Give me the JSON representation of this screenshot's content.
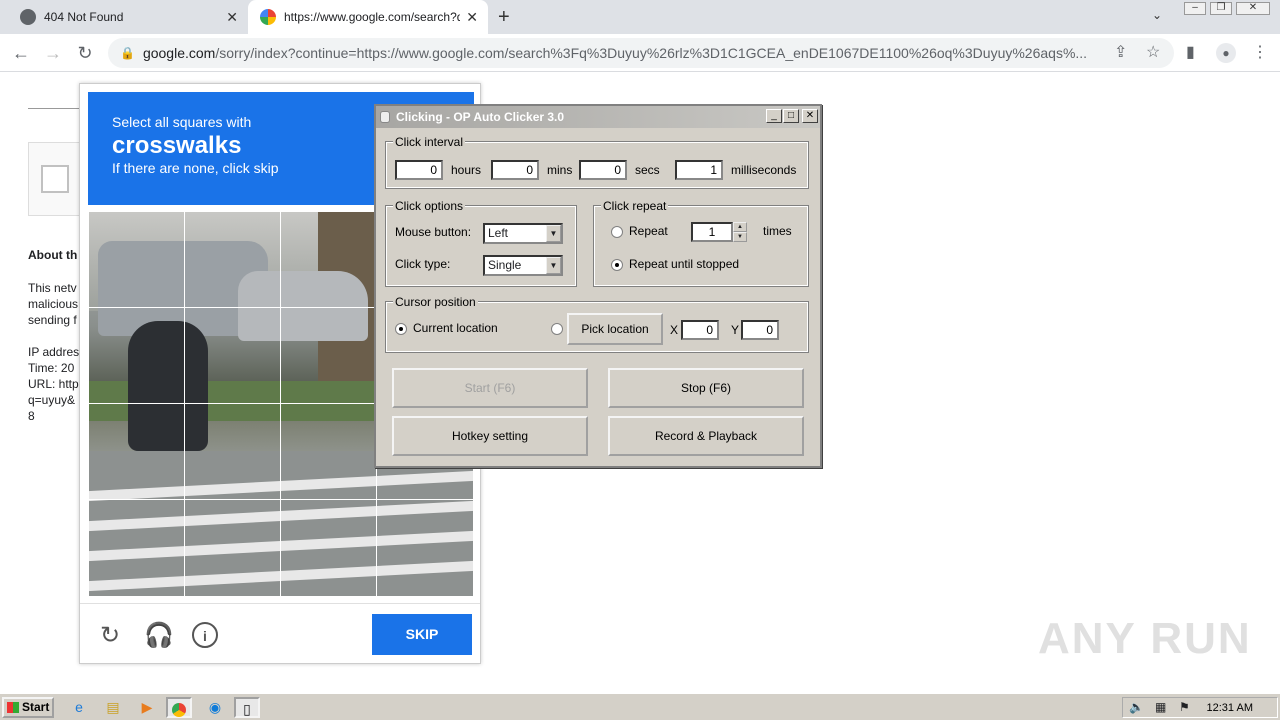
{
  "browser": {
    "tabs": [
      {
        "title": "404 Not Found",
        "close": "✕"
      },
      {
        "title": "https://www.google.com/search?q=",
        "close": "✕"
      }
    ],
    "new_tab": "+",
    "tab_search": "⌄",
    "url_host": "google.com",
    "url_rest": "/sorry/index?continue=https://www.google.com/search%3Fq%3Duyuy%26rlz%3D1C1GCEA_enDE1067DE1100%26oq%3Duyuy%26aqs%..."
  },
  "page": {
    "about_title": "About th",
    "body_lines": [
      "This netv",
      "malicious",
      "sending f"
    ],
    "info_lines": [
      "IP addres",
      "Time: 20",
      "URL: http",
      "q=uyuy&",
      "8"
    ]
  },
  "recaptcha": {
    "line1": "Select all squares with",
    "line2": "crosswalks",
    "line3": "If there are none, click skip",
    "skip_label": "SKIP"
  },
  "clicker": {
    "title": "Clicking - OP Auto Clicker 3.0",
    "interval_group": "Click interval",
    "hours_value": "0",
    "hours_label": "hours",
    "mins_value": "0",
    "mins_label": "mins",
    "secs_value": "0",
    "secs_label": "secs",
    "ms_value": "1",
    "ms_label": "milliseconds",
    "options_group": "Click options",
    "mouse_button_label": "Mouse button:",
    "mouse_button_value": "Left",
    "click_type_label": "Click type:",
    "click_type_value": "Single",
    "repeat_group": "Click repeat",
    "repeat_label": "Repeat",
    "repeat_value": "1",
    "times_label": "times",
    "repeat_until_label": "Repeat until stopped",
    "cursor_group": "Cursor position",
    "current_location_label": "Current location",
    "pick_location_label": "Pick location",
    "x_label": "X",
    "x_value": "0",
    "y_label": "Y",
    "y_value": "0",
    "start_label": "Start (F6)",
    "stop_label": "Stop (F6)",
    "hotkey_label": "Hotkey setting",
    "record_label": "Record & Playback"
  },
  "taskbar": {
    "start_label": "Start",
    "clock": "12:31 AM"
  },
  "watermark": "ANY RUN"
}
